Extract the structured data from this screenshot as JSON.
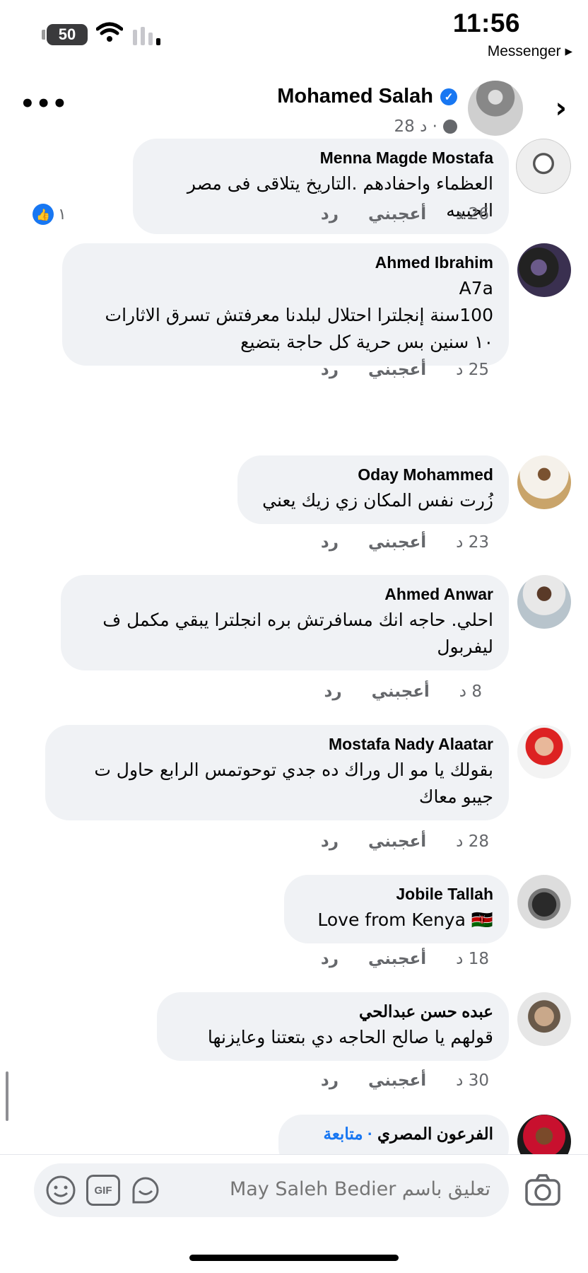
{
  "status_bar": {
    "time": "11:56",
    "battery": "50",
    "back_app": "Messenger ▸"
  },
  "post_header": {
    "author": "Mohamed Salah",
    "meta_time": "28 د ·",
    "more_icon": "•••",
    "chevron_icon": "›"
  },
  "comments": [
    {
      "name": "Menna Magde Mostafa",
      "text": "العظماء  واحفادهم .التاريخ يتلاقى فى مصر الحبيبه",
      "time": "26 د",
      "like": "أعجبني",
      "reply": "رد",
      "reactions": "١"
    },
    {
      "name": "Ahmed Ibrahim",
      "text": "A7a\n100سنة إنجلترا احتلال لبلدنا معرفتش تسرق الاثارات\n١٠ سنين بس حرية كل حاجة بتضيع",
      "time": "25 د",
      "like": "أعجبني",
      "reply": "رد"
    },
    {
      "name": "Oday Mohammed",
      "text": "زُرت نفس المكان زي زيك يعني",
      "time": "23 د",
      "like": "أعجبني",
      "reply": "رد"
    },
    {
      "name": "Ahmed Anwar",
      "text": "احلي. حاجه انك مسافرتش بره انجلترا يبقي مكمل ف\nليفربول",
      "time": "8 د",
      "like": "أعجبني",
      "reply": "رد"
    },
    {
      "name": "Mostafa Nady Alaatar",
      "text": "بقولك يا مو ال وراك ده جدي توحوتمس الرابع حاول ت\nجيبو معاك",
      "time": "28 د",
      "like": "أعجبني",
      "reply": "رد"
    },
    {
      "name": "Jobile Tallah",
      "text": "Love from Kenya 🇰🇪",
      "time": "18 د",
      "like": "أعجبني",
      "reply": "رد"
    },
    {
      "name": "عبده حسن عبدالحي",
      "text": "قولهم يا صالح الحاجه دي بتعتنا وعايزنها",
      "time": "30 د",
      "like": "أعجبني",
      "reply": "رد"
    },
    {
      "name": "الفرعون  المصري",
      "follow": "· متابعة"
    }
  ],
  "composer": {
    "placeholder": "تعليق باسم May Saleh Bedier",
    "gif_label": "GIF"
  },
  "icons": [
    "battery-icon",
    "wifi-icon",
    "signal-icon",
    "more-icon",
    "verified-icon",
    "globe-icon",
    "chevron-right-icon",
    "like-icon",
    "emoji-icon",
    "gif-icon",
    "sticker-icon",
    "camera-icon"
  ],
  "colors": {
    "accent": "#1877f2",
    "bubble": "#f0f2f5",
    "muted": "#65676b"
  }
}
